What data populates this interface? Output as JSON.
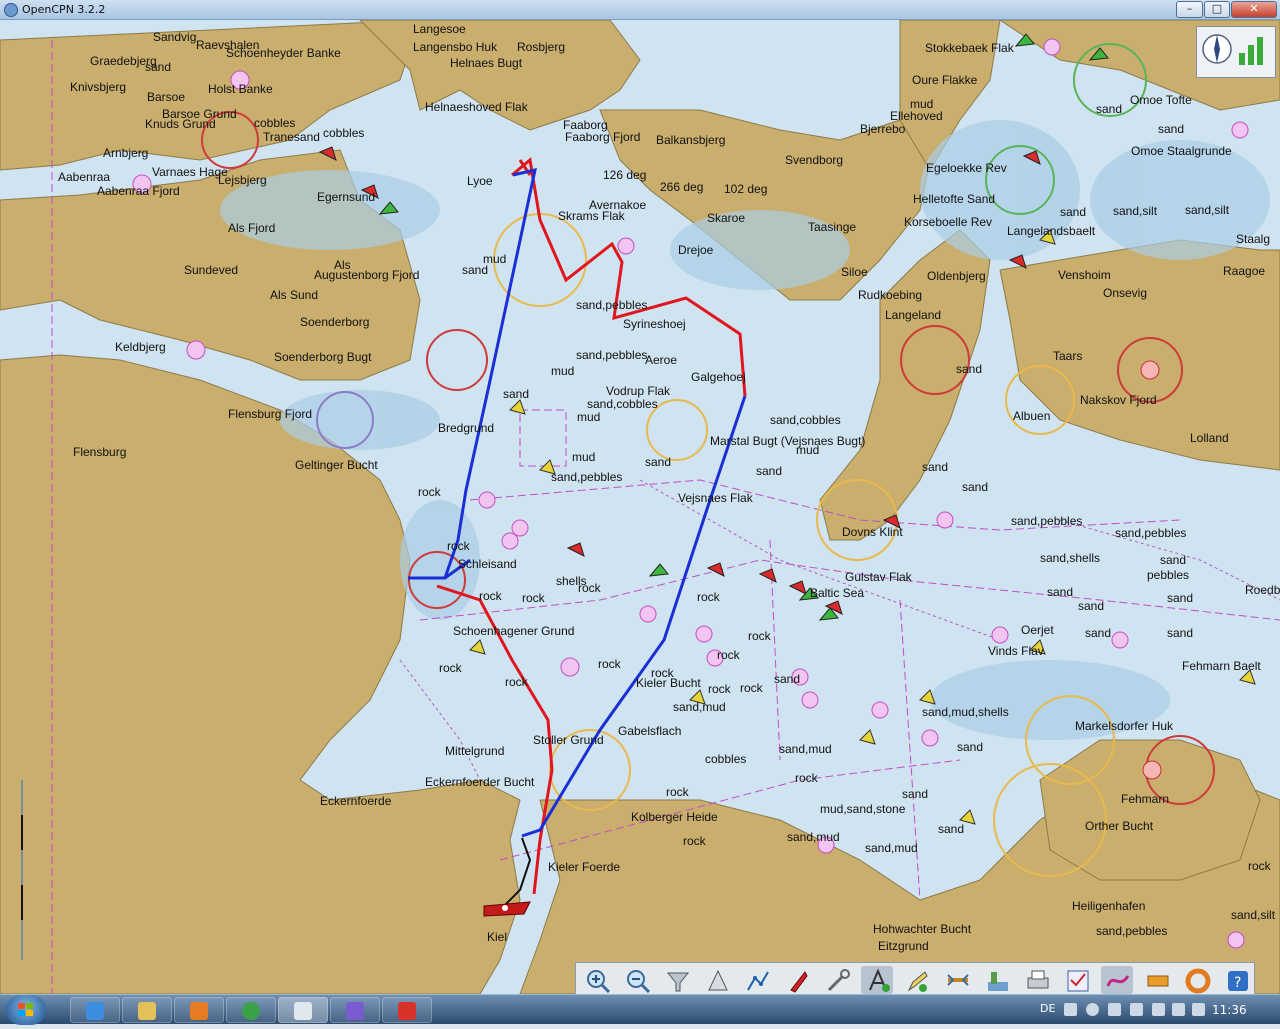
{
  "window": {
    "title": "OpenCPN 3.2.2",
    "controls": {
      "minimize": "–",
      "maximize": "□",
      "close": "✕"
    }
  },
  "chart": {
    "places": [
      "Sandvig",
      "Raevshalen",
      "Schoenheyder Banke",
      "Graedebjerg",
      "Knivsbjerg",
      "Barsoe",
      "Holst Banke",
      "Barsoe Grund",
      "Knuds Grund",
      "Tranesand",
      "Arnbjerg",
      "Aabenraa",
      "Aabenraa Fjord",
      "Varnaes Hage",
      "Lejsbjerg",
      "Egernsund",
      "Als Fjord",
      "Als",
      "Sundeved",
      "Augustenborg Fjord",
      "Als Sund",
      "Soenderborg",
      "Keldbjerg",
      "Soenderborg Bugt",
      "Flensburg Fjord",
      "Flensburg",
      "Geltinger Bucht",
      "Langesoe",
      "Langensbo Huk",
      "Rosbjerg",
      "Helnaes Bugt",
      "Helnaeshoved Flak",
      "Faaborg",
      "Faaborg Fjord",
      "Lyoe",
      "Svendborg",
      "Taasinge",
      "Drejoe",
      "Siloe",
      "Skaroe",
      "Avernakoe",
      "Rudkoebing",
      "Langeland",
      "Syrineshoej",
      "Aeroe",
      "Vodrup Flak",
      "Galgehoej",
      "Marstal Bugt (Vejsnaes Bugt)",
      "Vejsnaes Flak",
      "Dovns Klint",
      "Gulstav Flak",
      "Baltic Sea",
      "Kieler Bucht",
      "Schleisand",
      "Schoenhagener Grund",
      "Mittelgrund",
      "Eckernfoerder Bucht",
      "Eckernfoerde",
      "Stoller Grund",
      "Gabelsflach",
      "Kolberger Heide",
      "Kieler Foerde",
      "Kiel",
      "Hohwachter Bucht",
      "Eitzgrund",
      "Fehmarn",
      "Fehmarn Baelt",
      "Orther Bucht",
      "Markelsdorfer Huk",
      "Heiligenhafen",
      "Lolland",
      "Omoe Tofte",
      "Omoe Staalgrunde",
      "Langelandsbaelt",
      "Egeloekke Rev",
      "Helletofte Sand",
      "Korseboelle Rev",
      "Venshoim",
      "Onsevig",
      "Taars",
      "Nakskov Fjord",
      "Albuen",
      "Oldenbjerg",
      "Stokkebaek Flak",
      "Oure Flakke",
      "Bjerrebo",
      "Ellehoved",
      "Balkansbjerg",
      "Skrams Flak",
      "Bredgrund",
      "Staalg",
      "Raagoe",
      "Vinds Flav",
      "Oerjet",
      "Roedb"
    ],
    "seabed": [
      "sand",
      "mud",
      "rock",
      "cobbles",
      "shells",
      "sand,pebbles",
      "sand,cobbles",
      "sand,mud",
      "sand,shells",
      "sand,silt",
      "mud,sand,stone",
      "sand,mud,shells",
      "pebbles"
    ],
    "bearings": [
      "126 deg",
      "266 deg",
      "102 deg"
    ],
    "route_colors": {
      "outbound": "#e0161e",
      "return": "#1a2fd6",
      "track": "#111111"
    }
  },
  "status_tools": {
    "compass": "compass-icon",
    "signal": "gps-signal-icon"
  },
  "toolbar": {
    "buttons": [
      "zoom-in",
      "zoom-out",
      "quilt",
      "tide",
      "route",
      "ais",
      "measure",
      "text",
      "edit",
      "current",
      "layers",
      "print",
      "settings",
      "track",
      "night",
      "mob",
      "help"
    ]
  },
  "taskbar": {
    "language": "DE",
    "clock": "11:36",
    "tasks": [
      "internet-explorer",
      "file-explorer",
      "media-player",
      "chrome",
      "opencpn",
      "network-app",
      "red-app"
    ]
  }
}
